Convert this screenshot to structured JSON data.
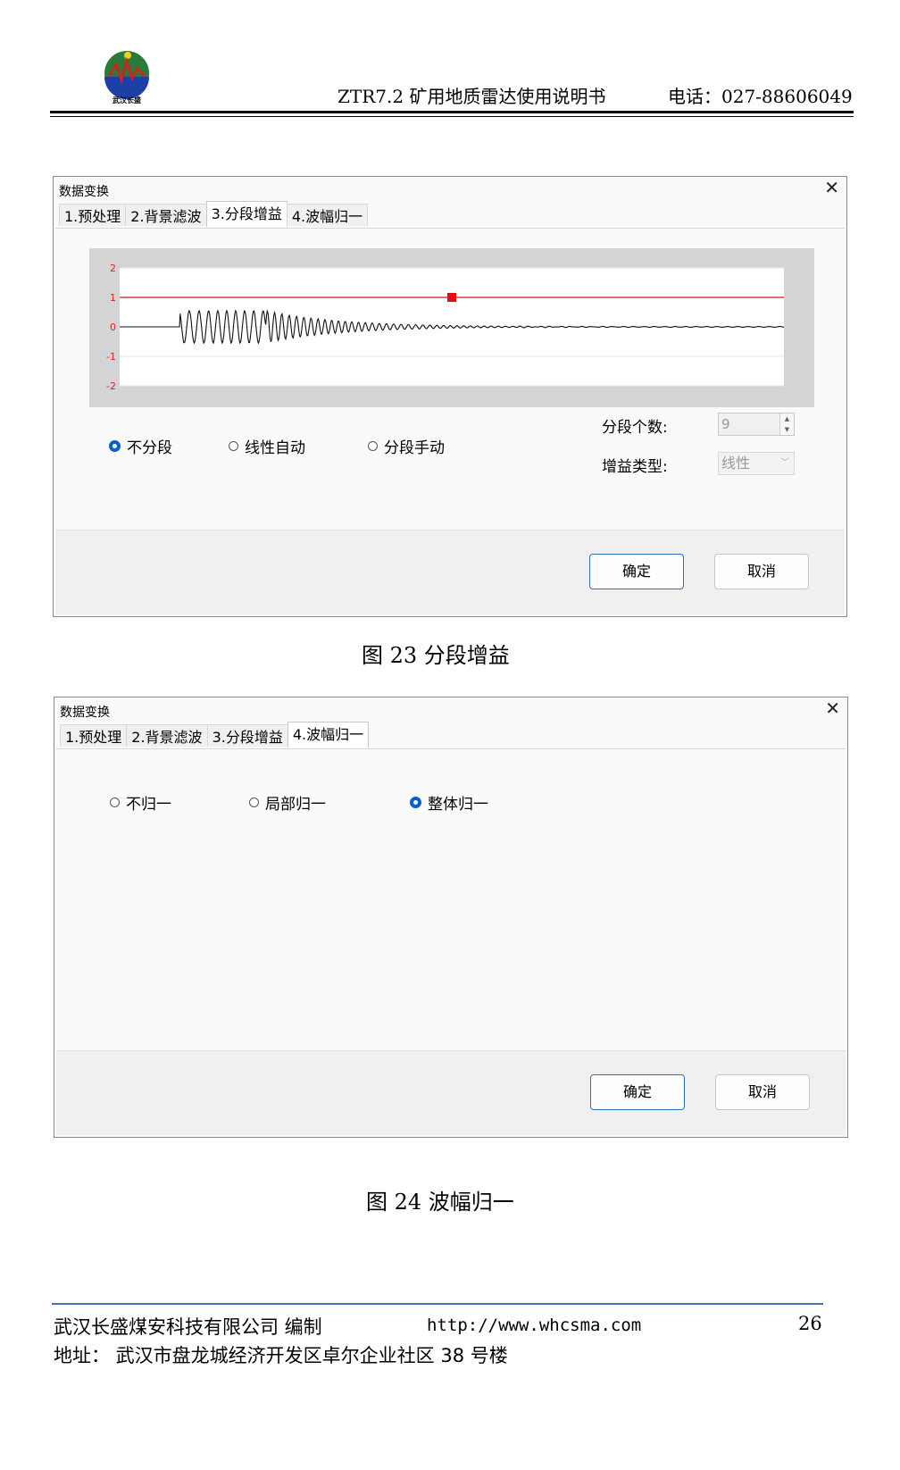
{
  "header": {
    "logo_text": "武汉长盛",
    "title": "ZTR7.2 矿用地质雷达使用说明书",
    "phone": "电话：027-88606049"
  },
  "dialog1": {
    "title": "数据变换",
    "close": "✕",
    "tabs": [
      "1.预处理",
      "2.背景滤波",
      "3.分段增益",
      "4.波幅归一"
    ],
    "active_tab": 2,
    "chart_data": {
      "type": "line",
      "ylim": [
        -2,
        2
      ],
      "y_ticks": [
        "2",
        "1",
        "0",
        "-1",
        "-2"
      ],
      "gain_line": 1,
      "signal": "radar trace"
    },
    "radios": [
      "不分段",
      "线性自动",
      "分段手动"
    ],
    "selected_radio": 0,
    "segment_count_label": "分段个数:",
    "segment_count_value": "9",
    "gain_type_label": "增益类型:",
    "gain_type_value": "线性",
    "ok": "确定",
    "cancel": "取消"
  },
  "caption1": "图 23 分段增益",
  "dialog2": {
    "title": "数据变换",
    "close": "✕",
    "tabs": [
      "1.预处理",
      "2.背景滤波",
      "3.分段增益",
      "4.波幅归一"
    ],
    "active_tab": 3,
    "radios": [
      "不归一",
      "局部归一",
      "整体归一"
    ],
    "selected_radio": 2,
    "ok": "确定",
    "cancel": "取消"
  },
  "caption2": "图 24 波幅归一",
  "footer": {
    "company": "武汉长盛煤安科技有限公司 编制",
    "url": "http://www.whcsma.com",
    "page": "26",
    "address": "地址： 武汉市盘龙城经济开发区卓尔企业社区 38 号楼"
  }
}
